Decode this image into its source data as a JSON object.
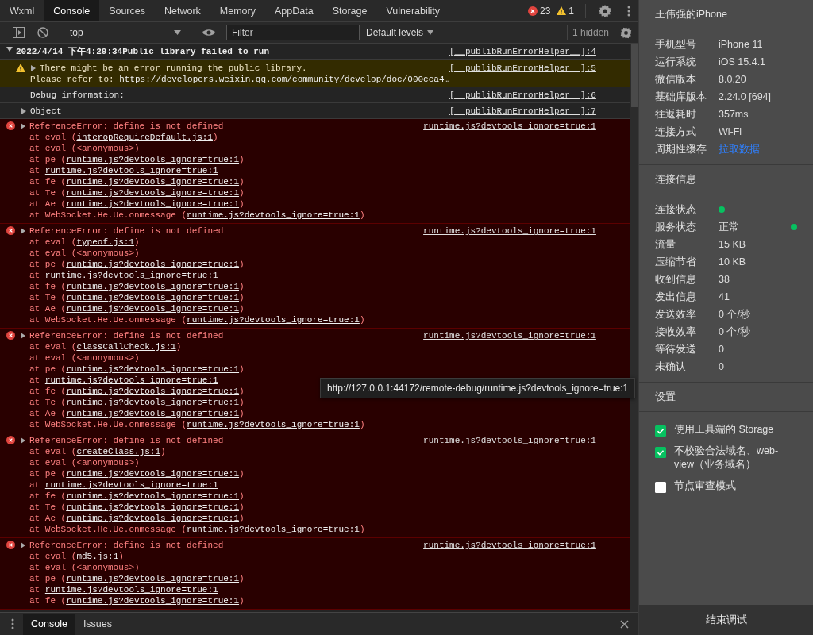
{
  "tabs": [
    {
      "label": "Wxml",
      "selected": false
    },
    {
      "label": "Console",
      "selected": true
    },
    {
      "label": "Sources",
      "selected": false
    },
    {
      "label": "Network",
      "selected": false
    },
    {
      "label": "Memory",
      "selected": false
    },
    {
      "label": "AppData",
      "selected": false
    },
    {
      "label": "Storage",
      "selected": false
    },
    {
      "label": "Vulnerability",
      "selected": false
    }
  ],
  "counters": {
    "errors": "23",
    "warnings": "1"
  },
  "toolbar": {
    "context": "top",
    "filter_placeholder": "Filter",
    "levels": "Default levels",
    "hidden": "1 hidden"
  },
  "group": {
    "title": "2022/4/14 下午4:29:34Public library failed to run",
    "source": "[__publibRunErrorHelper__]:4",
    "expanded": true,
    "messages": [
      {
        "kind": "warning",
        "text": "There might be an error running the public library.",
        "prefix": "Please refer to: ",
        "link": "https://developers.weixin.qq.com/community/develop/doc/000cca4…",
        "source": "[__publibRunErrorHelper__]:5",
        "expanded": false
      },
      {
        "kind": "info",
        "text": "Debug information:",
        "source": "[__publibRunErrorHelper__]:6"
      },
      {
        "kind": "object",
        "text": "Object",
        "source": "[__publibRunErrorHelper__]:7",
        "expanded": false
      }
    ]
  },
  "errors": [
    {
      "message": "ReferenceError: define is not defined",
      "source": "runtime.js?devtools_ignore=true:1",
      "expanded": false,
      "frames": [
        {
          "pre": "at eval (",
          "link": "interopRequireDefault.js:1",
          "post": ")"
        },
        {
          "pre": "at eval (<anonymous>)"
        },
        {
          "pre": "at pe (",
          "link": "runtime.js?devtools_ignore=true:1",
          "post": ")"
        },
        {
          "pre": "at ",
          "link": "runtime.js?devtools_ignore=true:1"
        },
        {
          "pre": "at fe (",
          "link": "runtime.js?devtools_ignore=true:1",
          "post": ")"
        },
        {
          "pre": "at Te (",
          "link": "runtime.js?devtools_ignore=true:1",
          "post": ")"
        },
        {
          "pre": "at Ae (",
          "link": "runtime.js?devtools_ignore=true:1",
          "post": ")"
        },
        {
          "pre": "at WebSocket.He.Ue.onmessage (",
          "link": "runtime.js?devtools_ignore=true:1",
          "post": ")"
        }
      ]
    },
    {
      "message": "ReferenceError: define is not defined",
      "source": "runtime.js?devtools_ignore=true:1",
      "expanded": false,
      "frames": [
        {
          "pre": "at eval (",
          "link": "typeof.js:1",
          "post": ")"
        },
        {
          "pre": "at eval (<anonymous>)"
        },
        {
          "pre": "at pe (",
          "link": "runtime.js?devtools_ignore=true:1",
          "post": ")"
        },
        {
          "pre": "at ",
          "link": "runtime.js?devtools_ignore=true:1"
        },
        {
          "pre": "at fe (",
          "link": "runtime.js?devtools_ignore=true:1",
          "post": ")"
        },
        {
          "pre": "at Te (",
          "link": "runtime.js?devtools_ignore=true:1",
          "post": ")"
        },
        {
          "pre": "at Ae (",
          "link": "runtime.js?devtools_ignore=true:1",
          "post": ")"
        },
        {
          "pre": "at WebSocket.He.Ue.onmessage (",
          "link": "runtime.js?devtools_ignore=true:1",
          "post": ")"
        }
      ]
    },
    {
      "message": "ReferenceError: define is not defined",
      "source": "runtime.js?devtools_ignore=true:1",
      "expanded": false,
      "frames": [
        {
          "pre": "at eval (",
          "link": "classCallCheck.js:1",
          "post": ")"
        },
        {
          "pre": "at eval (<anonymous>)"
        },
        {
          "pre": "at pe (",
          "link": "runtime.js?devtools_ignore=true:1",
          "post": ")"
        },
        {
          "pre": "at ",
          "link": "runtime.js?devtools_ignore=true:1"
        },
        {
          "pre": "at fe (",
          "link": "runtime.js?devtools_ignore=true:1",
          "post": ")"
        },
        {
          "pre": "at Te (",
          "link": "runtime.js?devtools_ignore=true:1",
          "post": ")"
        },
        {
          "pre": "at Ae (",
          "link": "runtime.js?devtools_ignore=true:1",
          "post": ")"
        },
        {
          "pre": "at WebSocket.He.Ue.onmessage (",
          "link": "runtime.js?devtools_ignore=true:1",
          "post": ")"
        }
      ]
    },
    {
      "message": "ReferenceError: define is not defined",
      "source": "runtime.js?devtools_ignore=true:1",
      "expanded": false,
      "frames": [
        {
          "pre": "at eval (",
          "link": "createClass.js:1",
          "post": ")"
        },
        {
          "pre": "at eval (<anonymous>)"
        },
        {
          "pre": "at pe (",
          "link": "runtime.js?devtools_ignore=true:1",
          "post": ")"
        },
        {
          "pre": "at ",
          "link": "runtime.js?devtools_ignore=true:1"
        },
        {
          "pre": "at fe (",
          "link": "runtime.js?devtools_ignore=true:1",
          "post": ")"
        },
        {
          "pre": "at Te (",
          "link": "runtime.js?devtools_ignore=true:1",
          "post": ")"
        },
        {
          "pre": "at Ae (",
          "link": "runtime.js?devtools_ignore=true:1",
          "post": ")"
        },
        {
          "pre": "at WebSocket.He.Ue.onmessage (",
          "link": "runtime.js?devtools_ignore=true:1",
          "post": ")"
        }
      ]
    },
    {
      "message": "ReferenceError: define is not defined",
      "source": "runtime.js?devtools_ignore=true:1",
      "expanded": false,
      "frames": [
        {
          "pre": "at eval (",
          "link": "md5.js:1",
          "post": ")"
        },
        {
          "pre": "at eval (<anonymous>)"
        },
        {
          "pre": "at pe (",
          "link": "runtime.js?devtools_ignore=true:1",
          "post": ")"
        },
        {
          "pre": "at ",
          "link": "runtime.js?devtools_ignore=true:1"
        },
        {
          "pre": "at fe (",
          "link": "runtime.js?devtools_ignore=true:1",
          "post": ")"
        }
      ]
    }
  ],
  "tooltip": "http://127.0.0.1:44172/remote-debug/runtime.js?devtools_ignore=true:1",
  "drawer_tabs": [
    {
      "label": "Console",
      "selected": true
    },
    {
      "label": "Issues",
      "selected": false
    }
  ],
  "panel": {
    "device": "王伟强的iPhone",
    "info": [
      {
        "label": "手机型号",
        "value": "iPhone 11",
        "kind": "text"
      },
      {
        "label": "运行系统",
        "value": "iOS 15.4.1",
        "kind": "text"
      },
      {
        "label": "微信版本",
        "value": "8.0.20",
        "kind": "text"
      },
      {
        "label": "基础库版本",
        "value": "2.24.0 [694]",
        "kind": "text"
      },
      {
        "label": "往返耗时",
        "value": "357ms",
        "kind": "text"
      },
      {
        "label": "连接方式",
        "value": "Wi-Fi",
        "kind": "text"
      },
      {
        "label": "周期性缓存",
        "value": "拉取数据",
        "kind": "link"
      }
    ],
    "connection_title": "连接信息",
    "connection": [
      {
        "label": "连接状态",
        "kind": "dot"
      },
      {
        "label": "服务状态",
        "value": "正常",
        "kind": "text_dot"
      },
      {
        "label": "流量",
        "value": "15 KB",
        "kind": "text"
      },
      {
        "label": "压缩节省",
        "value": "10 KB",
        "kind": "text"
      },
      {
        "label": "收到信息",
        "value": "38",
        "kind": "text"
      },
      {
        "label": "发出信息",
        "value": "41",
        "kind": "text"
      },
      {
        "label": "发送效率",
        "value": "0 个/秒",
        "kind": "text"
      },
      {
        "label": "接收效率",
        "value": "0 个/秒",
        "kind": "text"
      },
      {
        "label": "等待发送",
        "value": "0",
        "kind": "text"
      },
      {
        "label": "未确认",
        "value": "0",
        "kind": "text"
      }
    ],
    "settings_title": "设置",
    "settings": [
      {
        "label": "使用工具端的 Storage",
        "checked": true
      },
      {
        "label": "不校验合法域名、web-view（业务域名）",
        "checked": true
      },
      {
        "label": "节点审查模式",
        "checked": false
      }
    ],
    "end_button": "结束调试"
  }
}
